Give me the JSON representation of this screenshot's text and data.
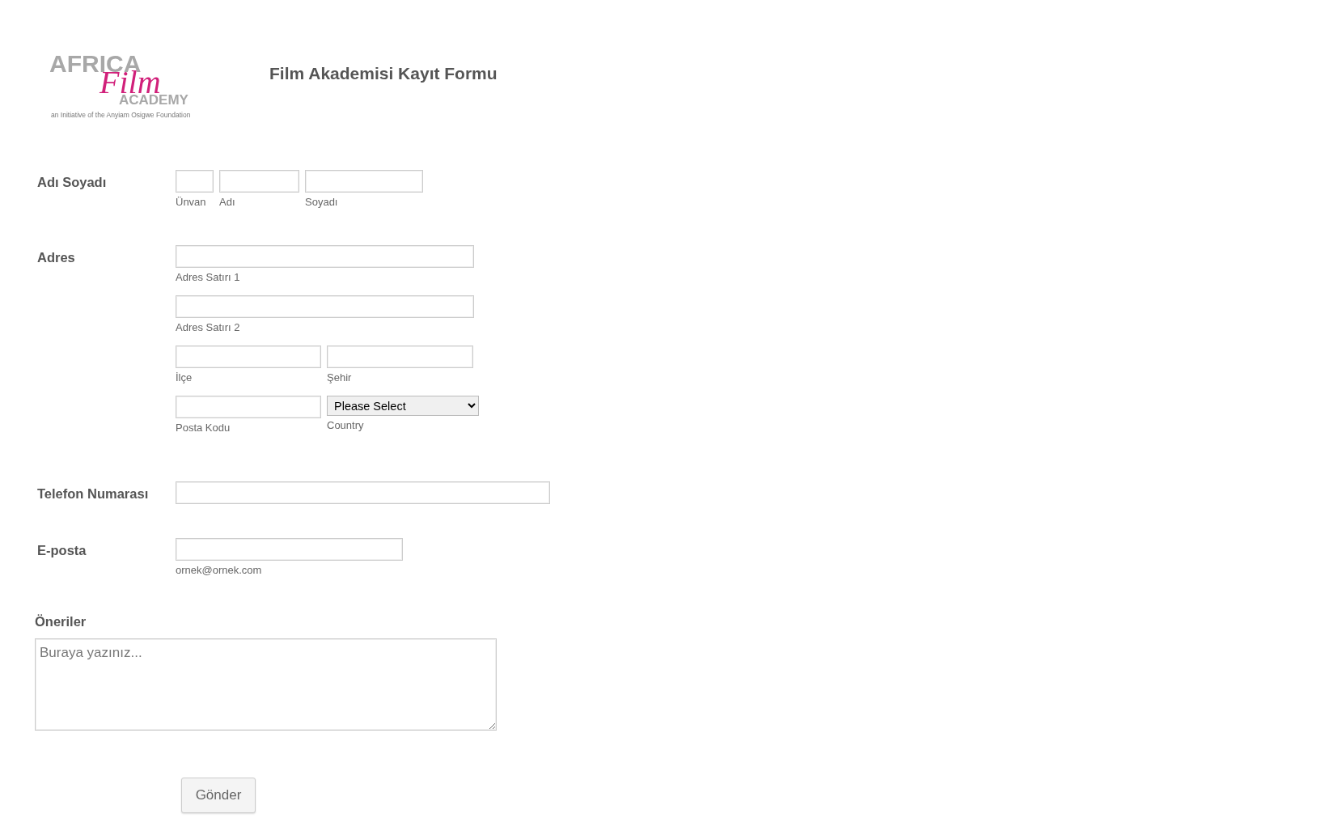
{
  "logo": {
    "texts": [
      "AFRICA",
      "Film",
      "ACADEMY",
      "an Initiative of the Anyiam Osigwe Foundation"
    ]
  },
  "title": "Film Akademisi Kayıt Formu",
  "fields": [
    {
      "kind": "name",
      "label": "Adı Soyadı",
      "rows": [
        [
          {
            "kind": "text",
            "sublabel": "Ünvan"
          },
          {
            "kind": "text",
            "sublabel": "Adı"
          },
          {
            "kind": "text",
            "sublabel": "Soyadı"
          }
        ]
      ]
    },
    {
      "kind": "address",
      "label": "Adres",
      "rows": [
        [
          {
            "kind": "text",
            "sublabel": "Adres Satırı 1"
          }
        ],
        [
          {
            "kind": "text",
            "sublabel": "Adres Satırı 2"
          }
        ],
        [
          {
            "kind": "text",
            "sublabel": "İlçe"
          },
          {
            "kind": "text",
            "sublabel": "Şehir"
          }
        ],
        [
          {
            "kind": "text",
            "sublabel": "Posta Kodu"
          },
          {
            "kind": "select",
            "value": "Please Select",
            "sublabel": "Country"
          }
        ]
      ]
    },
    {
      "kind": "phone",
      "label": "Telefon Numarası",
      "rows": [
        [
          {
            "kind": "text"
          }
        ]
      ]
    },
    {
      "kind": "email",
      "label": "E-posta",
      "rows": [
        [
          {
            "kind": "text",
            "sublabel": "ornek@ornek.com"
          }
        ]
      ]
    }
  ],
  "suggestions": {
    "label": "Öneriler",
    "placeholder": "Buraya yazınız..."
  },
  "submit": "Gönder"
}
